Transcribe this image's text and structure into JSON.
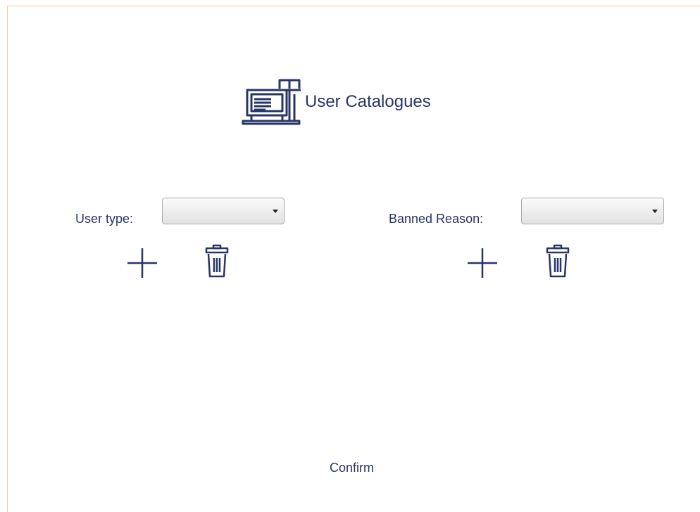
{
  "header": {
    "title": "User Catalogues",
    "icon": "laptop-book-icon"
  },
  "fields": [
    {
      "label": "User type:",
      "selected_value": ""
    },
    {
      "label": "Banned Reason:",
      "selected_value": ""
    }
  ],
  "actions": {
    "add_icon": "plus-icon",
    "delete_icon": "trash-icon"
  },
  "footer": {
    "confirm_label": "Confirm"
  },
  "colors": {
    "text": "#283567",
    "frame_border": "#f0c89a"
  }
}
